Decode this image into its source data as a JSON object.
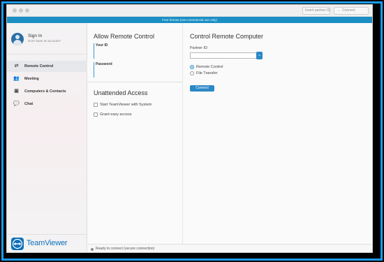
{
  "titlebar": {
    "insert_partner_label": "Insert partner ID",
    "connect_label": "Connect",
    "connect_icon": "arrow-right-icon"
  },
  "banner": {
    "text": "Free license (non-commercial use only)"
  },
  "sidebar": {
    "signin_label": "Sign In",
    "no_account_label": "Don't have an account?",
    "items": [
      {
        "label": "Remote Control",
        "icon": "arrows-icon",
        "active": true
      },
      {
        "label": "Meeting",
        "icon": "meeting-icon",
        "active": false
      },
      {
        "label": "Computers & Contacts",
        "icon": "contacts-icon",
        "active": false
      },
      {
        "label": "Chat",
        "icon": "chat-icon",
        "active": false
      }
    ],
    "logo_text": "TeamViewer"
  },
  "allow_remote": {
    "title": "Allow Remote Control",
    "your_id_label": "Your ID",
    "password_label": "Password"
  },
  "unattended": {
    "title": "Unattended Access",
    "options": [
      {
        "label": "Start TeamViewer with System",
        "checked": false
      },
      {
        "label": "Grant easy access",
        "checked": false
      }
    ]
  },
  "control_remote": {
    "title": "Control Remote Computer",
    "partner_id_label": "Partner ID",
    "partner_id_value": "",
    "modes": [
      {
        "label": "Remote Control",
        "selected": true
      },
      {
        "label": "File Transfer",
        "selected": false
      }
    ],
    "connect_label": "Connect"
  },
  "status": {
    "text": "Ready to connect (secure connection)"
  },
  "colors": {
    "accent": "#2b88c6",
    "banner": "#1b8fc4",
    "frame": "#1a9bf0"
  }
}
